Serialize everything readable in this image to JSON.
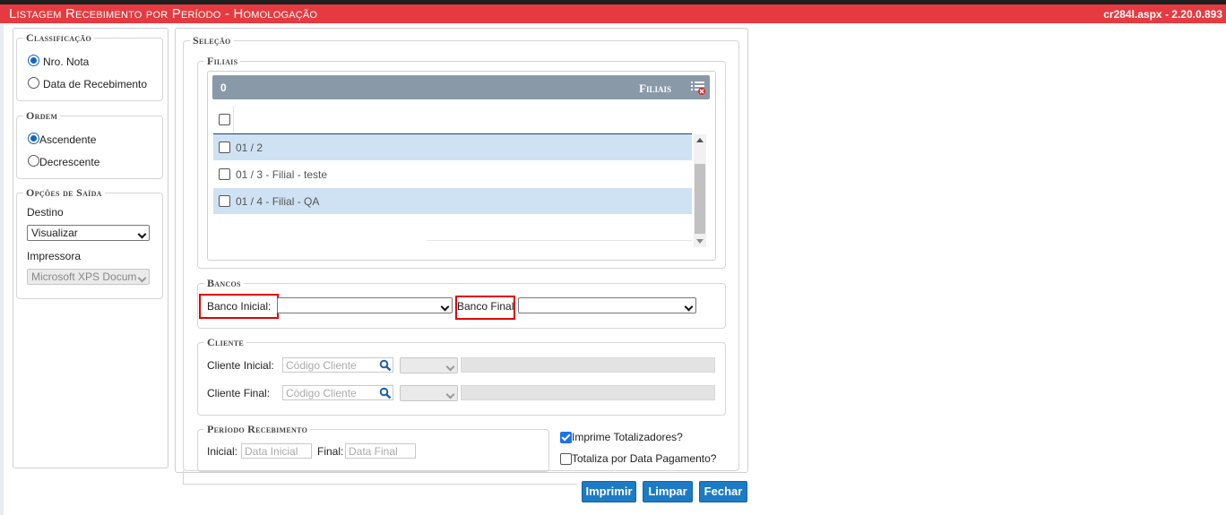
{
  "header": {
    "title": "Listagem Recebimento por Período  - Homologação",
    "version": "cr284l.aspx - 2.20.0.893"
  },
  "classificacao": {
    "legend": "Classificação",
    "options": [
      "Nro. Nota",
      "Data de Recebimento"
    ],
    "selected": "Nro. Nota"
  },
  "ordem": {
    "legend": "Ordem",
    "options": [
      "Ascendente",
      "Decrescente"
    ],
    "selected": "Ascendente"
  },
  "opcoes_saida": {
    "legend": "Opções de Saída",
    "destino_label": "Destino",
    "destino_value": "Visualizar",
    "impressora_label": "Impressora",
    "impressora_value": "Microsoft XPS Docum"
  },
  "selecao": {
    "legend": "Seleção",
    "filiais": {
      "legend": "Filiais",
      "count": "0",
      "header_title": "Filiais",
      "rows": [
        {
          "label": "01 / 2",
          "checked": false,
          "highlighted": true
        },
        {
          "label": "01 / 3 - Filial - teste",
          "checked": false,
          "highlighted": false
        },
        {
          "label": "01 / 4 - Filial - QA",
          "checked": false,
          "highlighted": true
        }
      ]
    },
    "bancos": {
      "legend": "Bancos",
      "inicial_label": "Banco Inicial:",
      "inicial_value": "",
      "final_label": "Banco Final",
      "final_value": ""
    },
    "cliente": {
      "legend": "Cliente",
      "inicial_label": "Cliente Inicial:",
      "final_label": "Cliente Final:",
      "placeholder": "Código Cliente"
    },
    "periodo": {
      "legend": "Período Recebimento",
      "inicial_label": "Inicial:",
      "inicial_placeholder": "Data Inicial",
      "final_label": "Final:",
      "final_placeholder": "Data Final"
    },
    "imprime_totalizadores": {
      "label": "Imprime Totalizadores?",
      "checked": true
    },
    "totaliza_data_pagamento": {
      "label": "Totaliza por Data Pagamento?",
      "checked": false
    }
  },
  "buttons": {
    "imprimir": "Imprimir",
    "limpar": "Limpar",
    "fechar": "Fechar"
  },
  "colors": {
    "title_bar": "#e63a40",
    "button": "#1c7bc4",
    "row_highlight": "#cfe2f3",
    "grid_header": "#8a99a8"
  }
}
